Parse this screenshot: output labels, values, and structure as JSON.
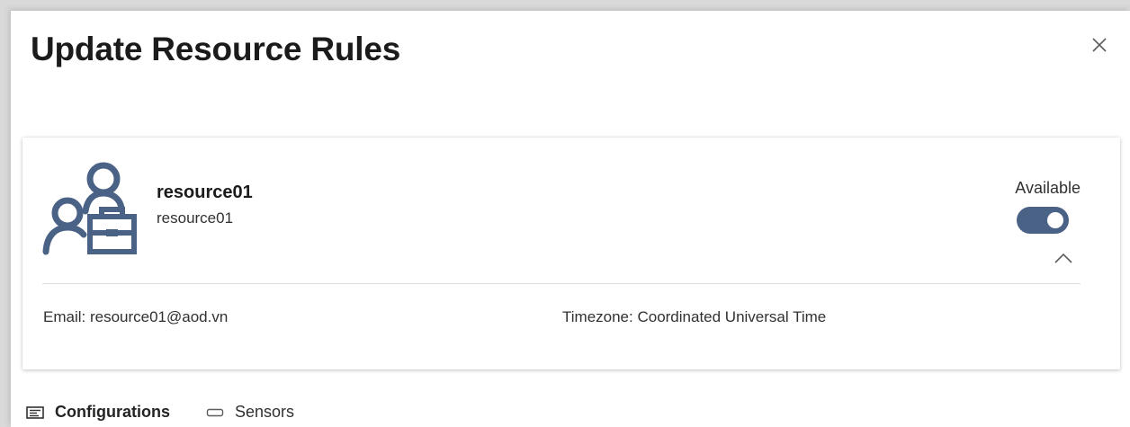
{
  "dialog": {
    "title": "Update Resource Rules",
    "close_icon": "close-icon"
  },
  "resource_card": {
    "avatar_icon": "resource-people-briefcase-icon",
    "name": "resource01",
    "subname": "resource01",
    "availability_label": "Available",
    "available": true,
    "toggle_color": "#4a6286",
    "collapse_icon": "chevron-up-icon",
    "email": "Email: resource01@aod.vn",
    "timezone": "Timezone: Coordinated Universal Time"
  },
  "tabs": [
    {
      "label": "Configurations",
      "icon": "configurations-icon",
      "active": true
    },
    {
      "label": "Sensors",
      "icon": "sensors-icon",
      "active": false
    }
  ]
}
